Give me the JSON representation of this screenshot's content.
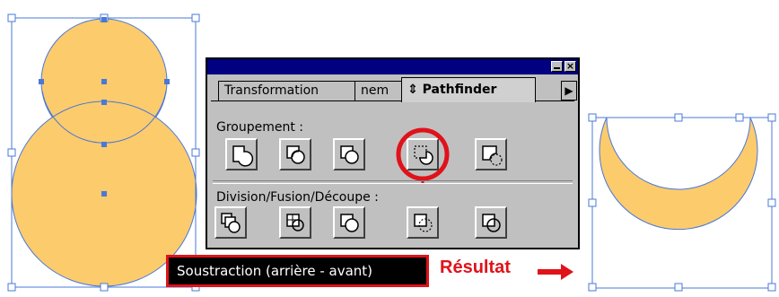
{
  "colors": {
    "fill": "#fccb6c",
    "selection": "#4a78d8",
    "highlight": "#e0121a",
    "panel": "#c0c0c0",
    "titlebar": "#000080"
  },
  "palette": {
    "close_glyph": "×",
    "tabs": [
      {
        "label": "Transformation"
      },
      {
        "label": "nem"
      },
      {
        "label": "Pathfinder",
        "prefix": "⇕",
        "active": true
      }
    ],
    "scroll_glyph": "▶",
    "groupement_label": "Groupement :",
    "division_label": "Division/Fusion/Découpe :",
    "groupement_buttons": [
      {
        "icon": "unite-icon"
      },
      {
        "icon": "intersect-icon"
      },
      {
        "icon": "exclude-icon"
      },
      {
        "icon": "minus-back-icon",
        "highlighted": true
      },
      {
        "icon": "minus-front-icon"
      }
    ],
    "division_buttons": [
      {
        "icon": "divide-icon"
      },
      {
        "icon": "trim-icon"
      },
      {
        "icon": "merge-icon"
      },
      {
        "icon": "crop-icon"
      },
      {
        "icon": "outline-icon"
      }
    ]
  },
  "tooltip": {
    "text": "Soustraction (arrière - avant)"
  },
  "result": {
    "label": "Résultat"
  }
}
